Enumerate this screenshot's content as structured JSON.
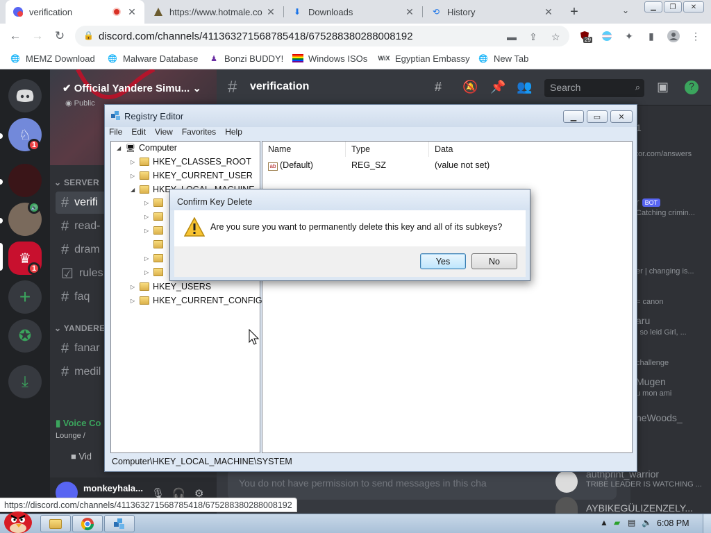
{
  "browser": {
    "tabs": [
      {
        "title": "verification",
        "active": true,
        "icon": "discord-icon"
      },
      {
        "title": "https://www.hotmale.co",
        "active": false,
        "icon": "grid-icon"
      },
      {
        "title": "Downloads",
        "active": false,
        "icon": "download-icon"
      },
      {
        "title": "History",
        "active": false,
        "icon": "history-icon"
      }
    ],
    "new_tab": "+",
    "url": "discord.com/channels/411363271568785418/675288380288008192",
    "extension_badge": "29",
    "bookmarks": [
      {
        "label": "MEMZ Download",
        "icon": "globe-icon"
      },
      {
        "label": "Malware Database",
        "icon": "globe-icon"
      },
      {
        "label": "Bonzi BUDDY!",
        "icon": "bonzi-icon"
      },
      {
        "label": "Windows ISOs",
        "icon": "rainbow-flag-icon"
      },
      {
        "label": "Egyptian Embassy",
        "icon": "wix-icon"
      },
      {
        "label": "New Tab",
        "icon": "globe-icon"
      }
    ],
    "status_url": "https://discord.com/channels/411363271568785418/675288380288008192"
  },
  "discord": {
    "guild_badges": [
      "1",
      "1"
    ],
    "server_name": "Official Yandere Simu...",
    "public_label": "Public",
    "categories": [
      "SERVER",
      "YANDERE S"
    ],
    "channels": [
      {
        "name": "verifi",
        "selected": true
      },
      {
        "name": "read-",
        "selected": false
      },
      {
        "name": "dram",
        "selected": false
      },
      {
        "name": "rules",
        "selected": false
      },
      {
        "name": "faq",
        "selected": false
      },
      {
        "name": "fanar",
        "selected": false
      },
      {
        "name": "medil",
        "selected": false
      }
    ],
    "voice_label": "Voice Co",
    "voice_sub": "Lounge /",
    "video_label": "Vid",
    "username": "monkeyhala...",
    "channel_title": "verification",
    "search_placeholder": "Search",
    "message_placeholder": "You do not have permission to send messages in this cha",
    "members": [
      {
        "text": "1"
      },
      {
        "text": "tor.com/answers"
      },
      {
        "text": "r",
        "bot": "BOT"
      },
      {
        "text": "Catching crimin..."
      },
      {
        "text": "er | changing is..."
      },
      {
        "text": "= canon"
      },
      {
        "text": "aru"
      },
      {
        "text": "i so leid Girl, ..."
      },
      {
        "text": "challenge"
      },
      {
        "text": "Mugen"
      },
      {
        "text": "u mon ami"
      },
      {
        "text": "neWoods_"
      },
      {
        "text": "authprint_warrior"
      },
      {
        "text": "TRIBE LEADER IS WATCHING ..."
      },
      {
        "text": "AYBIKEGÜLIZENZELY..."
      }
    ]
  },
  "regedit": {
    "title": "Registry Editor",
    "menu": [
      "File",
      "Edit",
      "View",
      "Favorites",
      "Help"
    ],
    "tree": {
      "root": "Computer",
      "hives": [
        "HKEY_CLASSES_ROOT",
        "HKEY_CURRENT_USER",
        "HKEY_LOCAL_MACHINE",
        "HKEY_USERS",
        "HKEY_CURRENT_CONFIG"
      ]
    },
    "columns": [
      "Name",
      "Type",
      "Data"
    ],
    "rows": [
      {
        "name": "(Default)",
        "type": "REG_SZ",
        "data": "(value not set)"
      }
    ],
    "status_path": "Computer\\HKEY_LOCAL_MACHINE\\SYSTEM"
  },
  "dialog": {
    "title": "Confirm Key Delete",
    "message": "Are you sure you want to permanently delete this key and all of its subkeys?",
    "yes": "Yes",
    "no": "No"
  },
  "taskbar": {
    "clock": "6:08 PM"
  }
}
